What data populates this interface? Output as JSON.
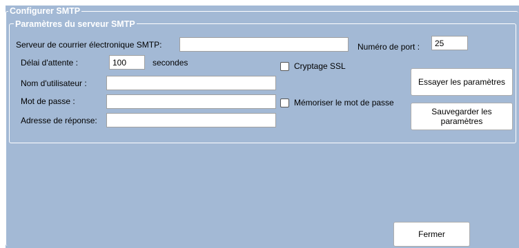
{
  "outer_group": {
    "title": "Configurer SMTP"
  },
  "server_group": {
    "title": "Paramètres du serveur SMTP"
  },
  "smtp_server": {
    "label": "Serveur de courrier électronique SMTP:",
    "value": ""
  },
  "port": {
    "label": "Numéro de port :",
    "value": "25"
  },
  "timeout": {
    "label": "Délai d'attente :",
    "value": "100",
    "unit": "secondes"
  },
  "ssl": {
    "label": "Cryptage SSL",
    "checked": false
  },
  "username": {
    "label": "Nom d'utilisateur :",
    "value": ""
  },
  "password": {
    "label": "Mot de passe :",
    "value": ""
  },
  "remember_password": {
    "label": "Mémoriser le mot de passe",
    "checked": false
  },
  "reply_address": {
    "label": "Adresse de réponse:",
    "value": ""
  },
  "buttons": {
    "test": "Essayer les paramètres",
    "save_line1": "Sauvegarder les",
    "save_line2": "paramètres",
    "close": "Fermer"
  },
  "colors": {
    "background": "#a3b9d5",
    "group_border": "#ffffff"
  }
}
